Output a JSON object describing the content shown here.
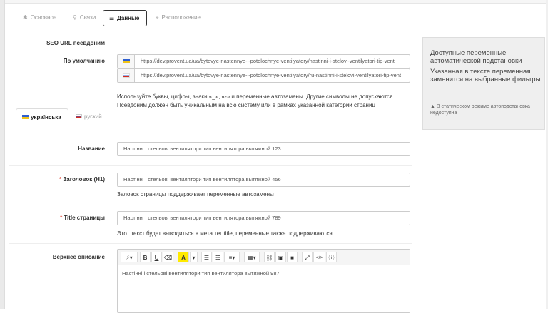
{
  "tabs": [
    {
      "label": "Основное",
      "icon": "asterisk-icon",
      "glyph": "✱"
    },
    {
      "label": "Связи",
      "icon": "link-icon",
      "glyph": "⚲"
    },
    {
      "label": "Данные",
      "icon": "list-icon",
      "glyph": "☰"
    },
    {
      "label": "Расположение",
      "icon": "location-icon",
      "glyph": "⌖"
    }
  ],
  "seo": {
    "label": "SEO URL псевдоним",
    "default_label": "По умолчанию",
    "url_ua": "https://dev.provent.ua/ua/bytovye-nastennye-i-potolochnye-ventilyatory/nastinni-i-stelovi-ventilyatori-tip-vent",
    "url_ru": "https://dev.provent.ua/ua/bytovye-nastennye-i-potolochnye-ventilyatory/ru-nastinni-i-stelovi-ventilyatori-tip-vent",
    "hint1": "Используйте буквы, цифры, знаки «_», «-» и переменные автозамены. Другие символы не допускаются.",
    "hint2": "Псевдоним должен быть уникальным на всю систему или в рамках указанной категории страниц"
  },
  "lang_tabs": [
    "українська",
    "руский"
  ],
  "fields": {
    "name_label": "Название",
    "name_value": "Настінні і стельові вентилятори тип вентилятора вытяжной  123",
    "h1_label": "Заголовок (H1)",
    "h1_value": "Настінні і стельові вентилятори тип вентилятора вытяжной  456",
    "h1_hint": "Заловок страницы поддерживает переменные автозамены",
    "title_label": "Title страницы",
    "title_value": "Настінні і стельові вентилятори тип вентилятора вытяжной  789",
    "title_hint": "Этот текст будет выводиться в мета тег title, переменные также поддерживаются",
    "desc_label": "Верхнее описание",
    "desc_value": "Настінні і стельові вентилятори тип вентилятора вытяжной  987"
  },
  "toolbar": [
    "magic-icon",
    "bold-icon",
    "underline-icon",
    "eraser-icon",
    "text-color-icon",
    "caret-icon",
    "unordered-list-icon",
    "ordered-list-icon",
    "align-icon",
    "table-icon",
    "link-icon",
    "image-icon",
    "video-icon",
    "fullscreen-icon",
    "code-icon",
    "info-icon"
  ],
  "toolbar_glyphs": [
    "⚡▾",
    "B",
    "U",
    "⌫",
    "A",
    "▾",
    "☰",
    "☷",
    "≡▾",
    "▦▾",
    "⛓",
    "▣",
    "■",
    "⤢",
    "</>",
    "ⓘ"
  ],
  "panel": {
    "title": "Доступные переменные автоматической подстановки",
    "desc": "Указанная в тексте переменная заменится на выбранные фильтры",
    "warning": "В статическом режиме автоподстановка недоступна"
  }
}
